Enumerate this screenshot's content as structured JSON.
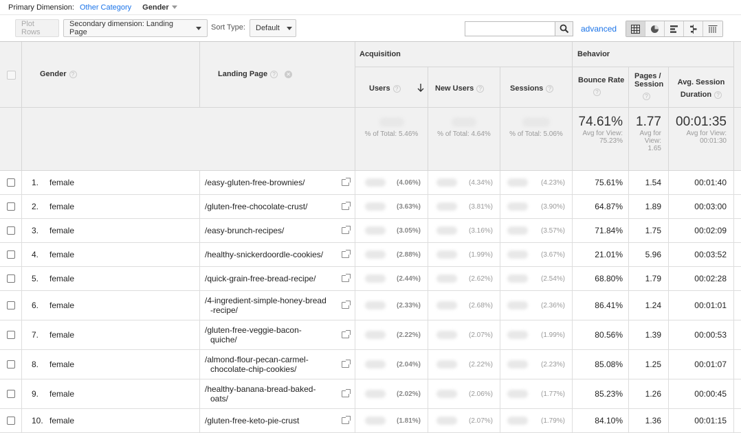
{
  "primary": {
    "label": "Primary Dimension:",
    "other": "Other Category",
    "selected": "Gender"
  },
  "toolbar": {
    "plot_rows": "Plot Rows",
    "secondary": "Secondary dimension: Landing Page",
    "sort_label": "Sort Type:",
    "sort_value": "Default",
    "search_placeholder": "",
    "advanced": "advanced"
  },
  "headers": {
    "gender": "Gender",
    "landing_page": "Landing Page",
    "acquisition": "Acquisition",
    "behavior": "Behavior",
    "users": "Users",
    "new_users": "New Users",
    "sessions": "Sessions",
    "bounce_rate": "Bounce Rate",
    "pages_session_1": "Pages /",
    "pages_session_2": "Session",
    "avg_session_1": "Avg. Session",
    "avg_session_2": "Duration",
    "help": "?"
  },
  "totals": {
    "users_pct": "% of Total: 5.46%",
    "new_users_pct": "% of Total: 4.64%",
    "sessions_pct": "% of Total: 5.06%",
    "bounce_rate": "74.61%",
    "bounce_avg_1": "Avg for View:",
    "bounce_avg_2": "75.23%",
    "pages": "1.77",
    "pages_avg_1": "Avg for",
    "pages_avg_2": "View:",
    "pages_avg_3": "1.65",
    "duration": "00:01:35",
    "duration_avg_1": "Avg for View:",
    "duration_avg_2": "00:01:30"
  },
  "rows": [
    {
      "n": "1.",
      "gender": "female",
      "page": "/easy-gluten-free-brownies/",
      "page2": "",
      "users": "(4.06%)",
      "new_users": "(4.34%)",
      "sessions": "(4.23%)",
      "bounce": "75.61%",
      "pages": "1.54",
      "duration": "00:01:40"
    },
    {
      "n": "2.",
      "gender": "female",
      "page": "/gluten-free-chocolate-crust/",
      "page2": "",
      "users": "(3.63%)",
      "new_users": "(3.81%)",
      "sessions": "(3.90%)",
      "bounce": "64.87%",
      "pages": "1.89",
      "duration": "00:03:00"
    },
    {
      "n": "3.",
      "gender": "female",
      "page": "/easy-brunch-recipes/",
      "page2": "",
      "users": "(3.05%)",
      "new_users": "(3.16%)",
      "sessions": "(3.57%)",
      "bounce": "71.84%",
      "pages": "1.75",
      "duration": "00:02:09"
    },
    {
      "n": "4.",
      "gender": "female",
      "page": "/healthy-snickerdoordle-cookies/",
      "page2": "",
      "users": "(2.88%)",
      "new_users": "(1.99%)",
      "sessions": "(3.67%)",
      "bounce": "21.01%",
      "pages": "5.96",
      "duration": "00:03:52"
    },
    {
      "n": "5.",
      "gender": "female",
      "page": "/quick-grain-free-bread-recipe/",
      "page2": "",
      "users": "(2.44%)",
      "new_users": "(2.62%)",
      "sessions": "(2.54%)",
      "bounce": "68.80%",
      "pages": "1.79",
      "duration": "00:02:28"
    },
    {
      "n": "6.",
      "gender": "female",
      "page": "/4-ingredient-simple-honey-bread",
      "page2": "-recipe/",
      "users": "(2.33%)",
      "new_users": "(2.68%)",
      "sessions": "(2.36%)",
      "bounce": "86.41%",
      "pages": "1.24",
      "duration": "00:01:01"
    },
    {
      "n": "7.",
      "gender": "female",
      "page": "/gluten-free-veggie-bacon-",
      "page2": "quiche/",
      "users": "(2.22%)",
      "new_users": "(2.07%)",
      "sessions": "(1.99%)",
      "bounce": "80.56%",
      "pages": "1.39",
      "duration": "00:00:53"
    },
    {
      "n": "8.",
      "gender": "female",
      "page": "/almond-flour-pecan-carmel-",
      "page2": "chocolate-chip-cookies/",
      "users": "(2.04%)",
      "new_users": "(2.22%)",
      "sessions": "(2.23%)",
      "bounce": "85.08%",
      "pages": "1.25",
      "duration": "00:01:07"
    },
    {
      "n": "9.",
      "gender": "female",
      "page": "/healthy-banana-bread-baked-",
      "page2": "oats/",
      "users": "(2.02%)",
      "new_users": "(2.06%)",
      "sessions": "(1.77%)",
      "bounce": "85.23%",
      "pages": "1.26",
      "duration": "00:00:45"
    },
    {
      "n": "10.",
      "gender": "female",
      "page": "/gluten-free-keto-pie-crust",
      "page2": "",
      "users": "(1.81%)",
      "new_users": "(2.07%)",
      "sessions": "(1.79%)",
      "bounce": "84.10%",
      "pages": "1.36",
      "duration": "00:01:15"
    }
  ]
}
